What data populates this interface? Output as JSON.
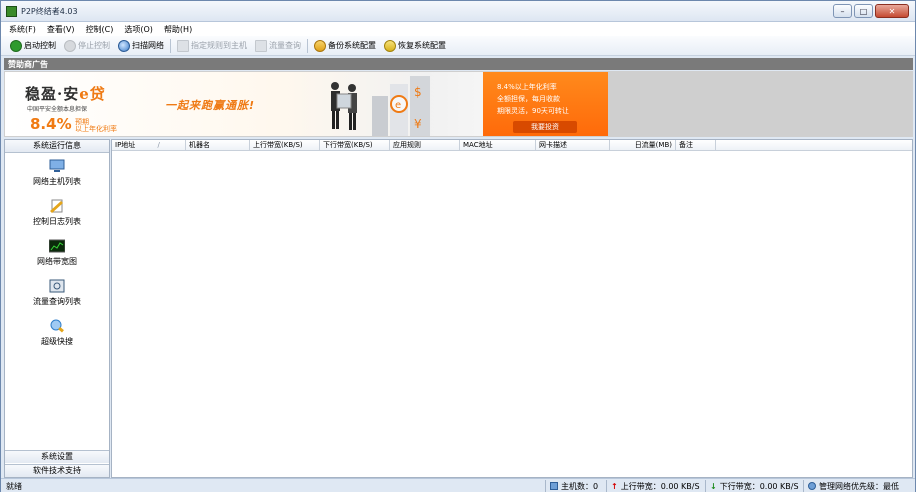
{
  "window": {
    "title": "P2P终结者4.03"
  },
  "menu": [
    "系统(F)",
    "查看(V)",
    "控制(C)",
    "选项(O)",
    "帮助(H)"
  ],
  "toolbar": [
    {
      "label": "启动控制",
      "icon": "play-control-icon",
      "enabled": true,
      "color": "#2e9a2e"
    },
    {
      "label": "停止控制",
      "icon": "stop-control-icon",
      "enabled": false,
      "color": "#b9bdc2"
    },
    {
      "label": "扫描网络",
      "icon": "scan-network-icon",
      "enabled": true,
      "color": "#3b7cc9"
    },
    {
      "label": "指定规则到主机",
      "icon": "assign-rule-icon",
      "enabled": false,
      "color": "#c3c8ce"
    },
    {
      "label": "流量查询",
      "icon": "traffic-query-icon",
      "enabled": false,
      "color": "#c3c8ce"
    },
    {
      "label": "备份系统配置",
      "icon": "backup-config-icon",
      "enabled": true,
      "color": "#e0a21a"
    },
    {
      "label": "恢复系统配置",
      "icon": "restore-config-icon",
      "enabled": true,
      "color": "#d9b21c"
    }
  ],
  "sponsor": {
    "label": "赞助商广告"
  },
  "ad": {
    "brand_a": "稳盈·安",
    "brand_b": "e贷",
    "sub": "中国平安全额本息担保",
    "rate": "8.4%",
    "rate_note_1": "预期",
    "rate_note_2": "以上年化利率",
    "slogan": "一起来跑赢通胀!",
    "bullets": [
      "8.4%以上年化利率",
      "全额担保，每月收款",
      "期限灵活，90天可转让"
    ],
    "cta": "我要投资"
  },
  "sidebar": {
    "header": "系统运行信息",
    "items": [
      {
        "label": "网络主机列表",
        "icon": "host-list-icon",
        "color": "#4a86c8"
      },
      {
        "label": "控制日志列表",
        "icon": "control-log-icon",
        "color": "#e4a51a"
      },
      {
        "label": "网络带宽图",
        "icon": "bandwidth-chart-icon",
        "color": "#1a6a1a"
      },
      {
        "label": "流量查询列表",
        "icon": "traffic-list-icon",
        "color": "#3a5a7a"
      },
      {
        "label": "超级快搜",
        "icon": "super-search-icon",
        "color": "#2f7ec9"
      }
    ],
    "footer_1": "系统设置",
    "footer_2": "软件技术支持"
  },
  "table": {
    "columns": [
      "IP地址",
      "机器名",
      "上行带宽(KB/S)",
      "下行带宽(KB/S)",
      "应用规则",
      "MAC地址",
      "网卡描述",
      "日流量(MB)",
      "备注"
    ],
    "sort_indicator": "/",
    "rows": []
  },
  "status": {
    "ready": "就绪",
    "hosts": "主机数：0",
    "upload": "上行带宽：0.00 KB/S",
    "download": "下行带宽：0.00 KB/S",
    "priority": "管理网络优先级：最低"
  }
}
